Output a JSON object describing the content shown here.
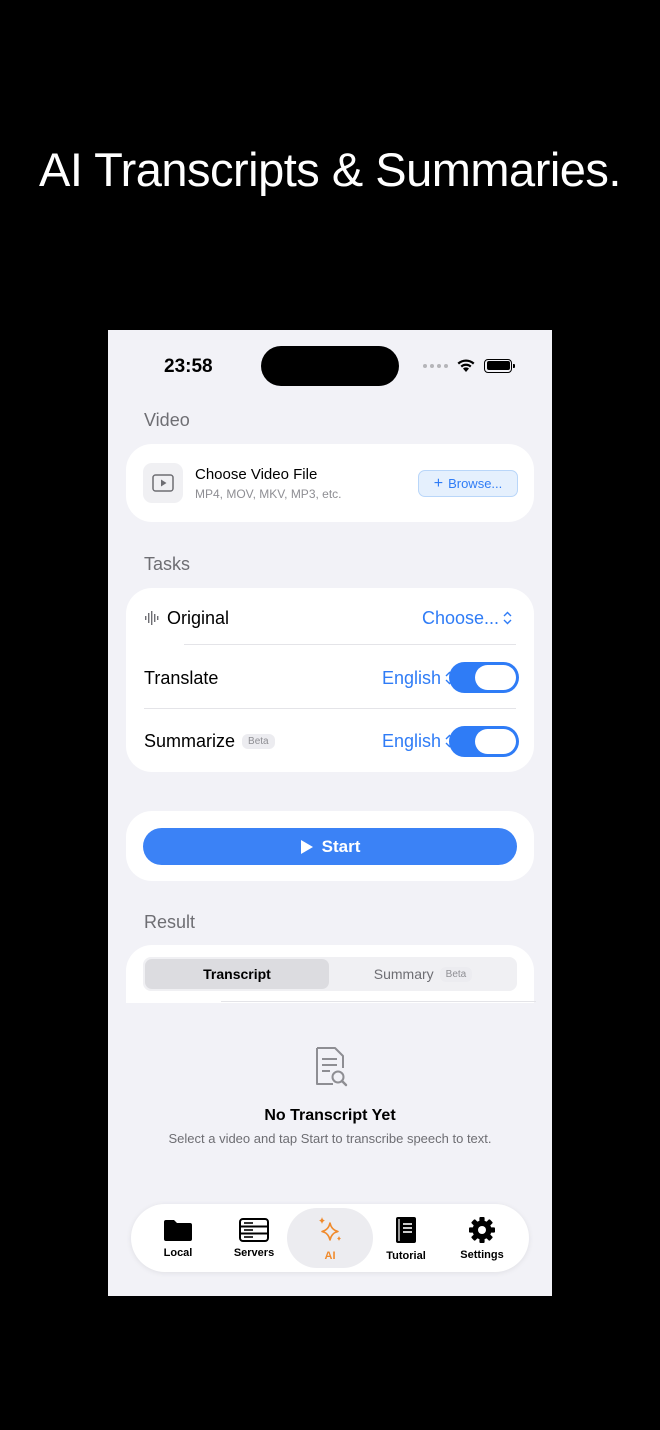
{
  "headline": "AI Transcripts & Summaries.",
  "status_bar": {
    "time": "23:58"
  },
  "video_section": {
    "label": "Video",
    "title": "Choose Video File",
    "formats": "MP4, MOV, MKV, MP3, etc.",
    "browse_label": "Browse..."
  },
  "tasks_section": {
    "label": "Tasks",
    "original": {
      "label": "Original",
      "value": "Choose..."
    },
    "translate": {
      "label": "Translate",
      "value": "English",
      "enabled": true
    },
    "summarize": {
      "label": "Summarize",
      "badge": "Beta",
      "value": "English",
      "enabled": true
    }
  },
  "start_button": {
    "label": "Start"
  },
  "result_section": {
    "label": "Result",
    "tabs": [
      {
        "label": "Transcript",
        "selected": true
      },
      {
        "label": "Summary",
        "badge": "Beta",
        "selected": false
      }
    ],
    "empty_title": "No Transcript Yet",
    "empty_subtitle": "Select a video and tap Start to transcribe speech to text."
  },
  "tab_bar": {
    "items": [
      {
        "label": "Local",
        "icon": "folder-icon"
      },
      {
        "label": "Servers",
        "icon": "server-icon"
      },
      {
        "label": "AI",
        "icon": "sparkles-icon",
        "active": true
      },
      {
        "label": "Tutorial",
        "icon": "book-icon"
      },
      {
        "label": "Settings",
        "icon": "gear-icon"
      }
    ]
  },
  "colors": {
    "accent": "#2f7cf6",
    "start_button": "#3b82f6",
    "ai_tab_active": "#f08a2c",
    "background": "#f2f2f7"
  }
}
